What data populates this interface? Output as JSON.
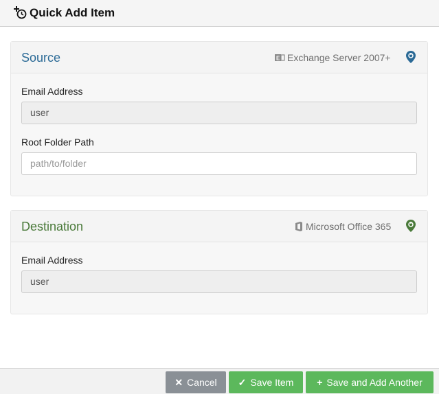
{
  "header": {
    "title": "Quick Add Item",
    "icon": "add-clock-icon"
  },
  "source": {
    "title": "Source",
    "server": "Exchange Server 2007+",
    "server_icon": "exchange-icon",
    "location_icon": "map-pin-icon",
    "email_label": "Email Address",
    "email_value": "user",
    "root_label": "Root Folder Path",
    "root_placeholder": "path/to/folder",
    "accent": "#2b6a96"
  },
  "destination": {
    "title": "Destination",
    "server": "Microsoft Office 365",
    "server_icon": "office-icon",
    "location_icon": "map-pin-icon",
    "email_label": "Email Address",
    "email_value": "user",
    "accent": "#4a7a3a"
  },
  "footer": {
    "cancel_label": "Cancel",
    "save_label": "Save Item",
    "save_add_label": "Save and Add Another",
    "cancel_color": "#8a9096",
    "save_color": "#5cb85c"
  }
}
